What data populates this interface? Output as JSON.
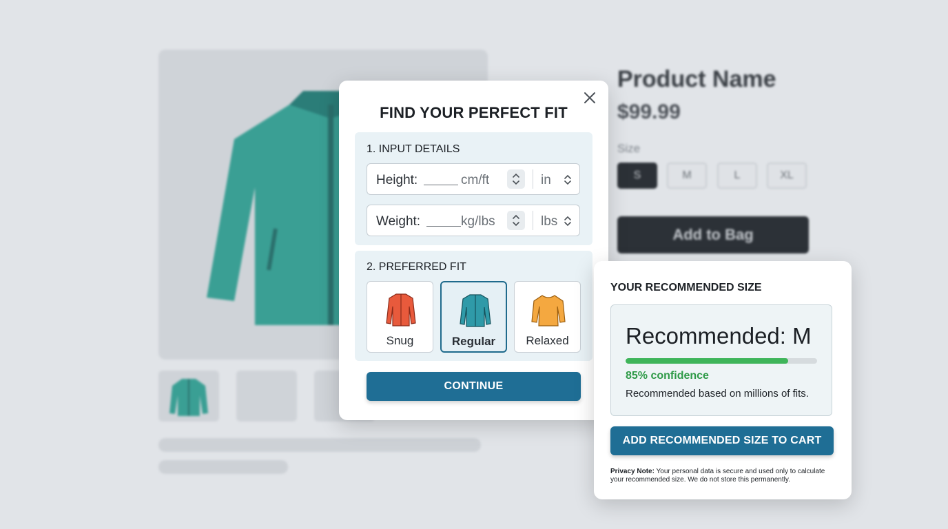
{
  "product": {
    "name": "Product Name",
    "price": "$99.99",
    "size_label": "Size",
    "sizes": [
      "S",
      "M",
      "L",
      "XL"
    ],
    "selected_size": "S",
    "add_to_bag": "Add to Bag"
  },
  "modal": {
    "title": "FIND YOUR PERFECT FIT",
    "section1_title": "1. INPUT DETAILS",
    "height": {
      "label": "Height:",
      "hint": "cm/ft",
      "unit": "in"
    },
    "weight": {
      "label": "Weight:",
      "hint": "kg/lbs",
      "unit": "lbs"
    },
    "section2_title": "2. PREFERRED FIT",
    "fits": [
      {
        "label": "Snug",
        "color": "#e85a3c"
      },
      {
        "label": "Regular",
        "color": "#2f9aa8"
      },
      {
        "label": "Relaxed",
        "color": "#f4a840"
      }
    ],
    "selected_fit": "Regular",
    "continue": "CONTINUE"
  },
  "recommendation": {
    "title": "YOUR RECOMMENDED SIZE",
    "size_text": "Recommended: M",
    "confidence": 0.85,
    "confidence_text": "85% confidence",
    "note": "Recommended based on millions of fits.",
    "add_button": "ADD RECOMMENDED SIZE TO CART",
    "privacy_label": "Privacy Note:",
    "privacy_text": "Your personal data is secure and used only to calculate your recommended size. We do not store this permanently."
  },
  "colors": {
    "accent": "#1f6e95",
    "success": "#3fb55a",
    "jacket": "#2f9a8e"
  }
}
